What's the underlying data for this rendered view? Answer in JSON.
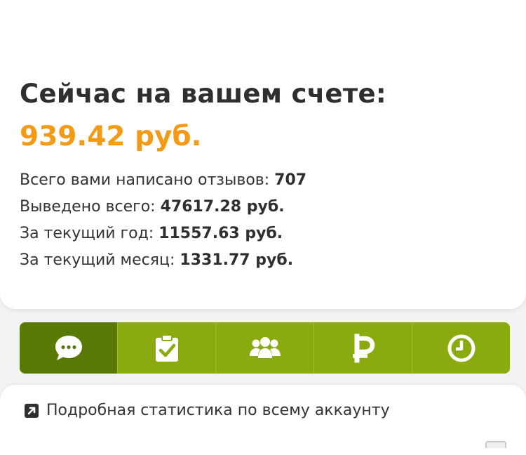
{
  "account": {
    "balance_title": "Сейчас на вашем счете:",
    "balance_amount": "939.42 руб."
  },
  "stats": [
    {
      "label": "Всего вами написано отзывов: ",
      "value": "707"
    },
    {
      "label": "Выведено всего: ",
      "value": "47617.28 руб."
    },
    {
      "label": "За текущий год: ",
      "value": "11557.63 руб."
    },
    {
      "label": "За текущий месяц: ",
      "value": "1331.77 руб."
    }
  ],
  "toolbar": {
    "tabs": [
      {
        "icon": "chat-bubble-icon",
        "active": true
      },
      {
        "icon": "clipboard-check-icon",
        "active": false
      },
      {
        "icon": "users-group-icon",
        "active": false
      },
      {
        "icon": "ruble-icon",
        "active": false
      },
      {
        "icon": "clock-icon",
        "active": false
      }
    ],
    "colors": {
      "background": "#8aab0f",
      "active": "#5a7a08"
    }
  },
  "footer_link": {
    "icon": "external-link-icon",
    "label": "Подробная статистика по всему аккаунту"
  },
  "colors": {
    "accent_orange": "#f59a14",
    "text_dark": "#2f2f2f"
  }
}
